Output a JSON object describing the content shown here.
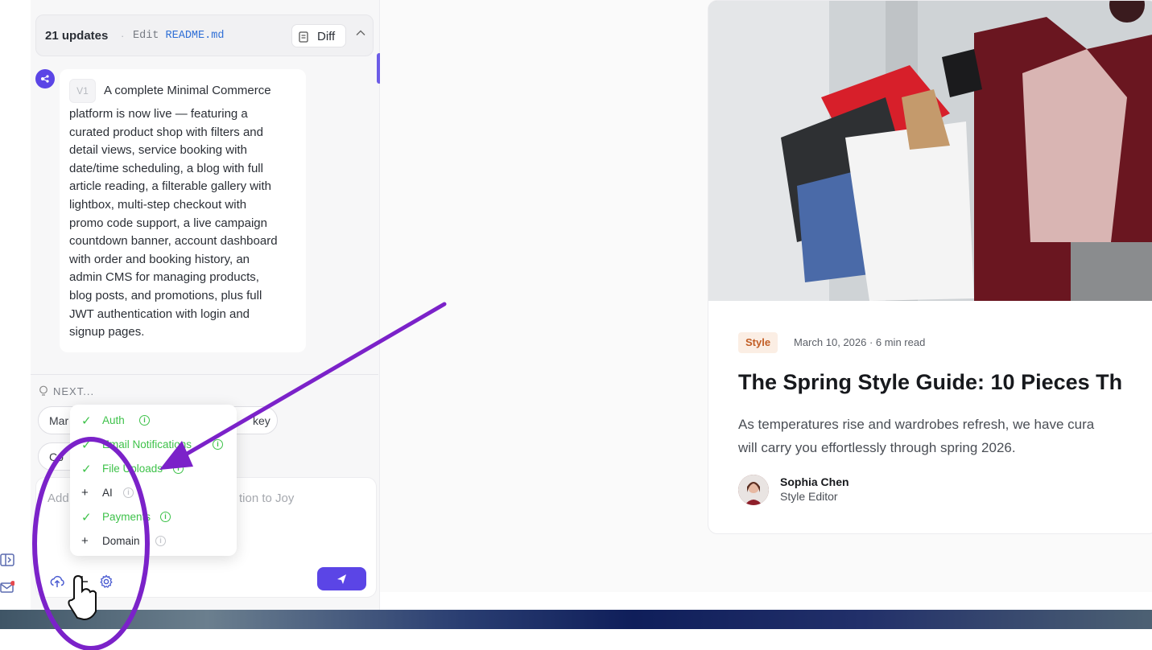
{
  "updates": {
    "count_label": "21 updates",
    "separator": "·",
    "edit_label": "Edit",
    "file_name": "README.md",
    "diff_label": "Diff"
  },
  "message": {
    "version_badge": "V1",
    "first_line": "A complete Minimal Commerce",
    "lines": [
      "platform is now live — featuring a",
      "curated product shop with filters and",
      "detail views, service booking with",
      "date/time scheduling, a blog with full",
      "article reading, a filterable gallery with",
      "lightbox, multi-step checkout with",
      "promo code support, a live campaign",
      "countdown banner, account dashboard",
      "with order and booking history, an",
      "admin CMS for managing products,",
      "blog posts, and promotions, plus full",
      "JWT authentication with login and",
      "signup pages."
    ]
  },
  "next": {
    "label": "NEXT...",
    "chips": [
      "Mar",
      "key",
      "Co"
    ]
  },
  "composer": {
    "placeholder_start": "Add",
    "placeholder_end": "tion to Joy"
  },
  "integrations_menu": [
    {
      "label": "Auth",
      "state": "enabled"
    },
    {
      "label": "Email Notifications",
      "state": "enabled"
    },
    {
      "label": "File Uploads",
      "state": "enabled"
    },
    {
      "label": "AI",
      "state": "add"
    },
    {
      "label": "Payments",
      "state": "enabled"
    },
    {
      "label": "Domain",
      "state": "add"
    }
  ],
  "article": {
    "tag": "Style",
    "meta": "March 10, 2026 · 6 min read",
    "headline": "The Spring Style Guide: 10 Pieces Th",
    "excerpt_lines": [
      "As temperatures rise and wardrobes refresh, we have cura",
      "will carry you effortlessly through spring 2026."
    ],
    "author_name": "Sophia Chen",
    "author_role": "Style Editor"
  },
  "colors": {
    "accent": "#5b45e6",
    "annotation": "#7b22c9",
    "success": "#3ec24a",
    "tag_bg": "#fbeee4",
    "tag_text": "#c25d24"
  }
}
